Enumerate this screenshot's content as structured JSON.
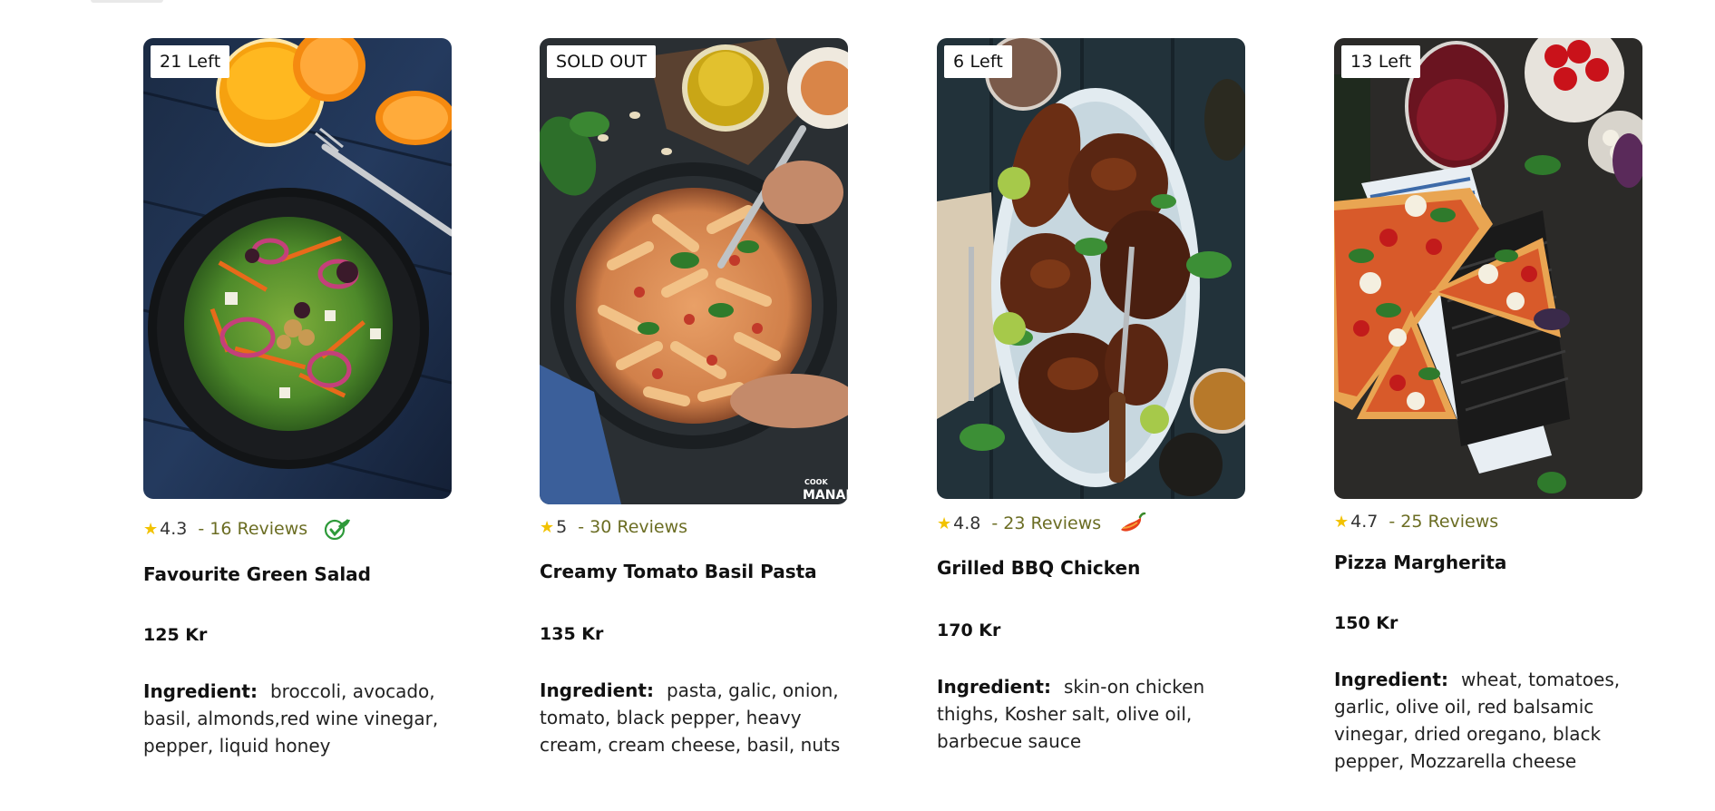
{
  "cards": [
    {
      "stock_badge": "21 Left",
      "rating": "4.3",
      "reviews": "- 16 Reviews",
      "flag_icon": "vegetarian-leaf-icon",
      "name": "Favourite Green Salad",
      "price": "125 Kr",
      "ingredient_label": "Ingredient:",
      "ingredients": "broccoli, avocado, basil, almonds,red wine vinegar, pepper, liquid honey"
    },
    {
      "stock_badge": "SOLD OUT",
      "rating": "5",
      "reviews": "- 30 Reviews",
      "flag_icon": "",
      "name": "Creamy Tomato Basil Pasta",
      "price": "135 Kr",
      "ingredient_label": "Ingredient:",
      "ingredients": "pasta, galic,  onion, tomato, black pepper, heavy cream, cream cheese, basil, nuts",
      "watermark": "COOK WITH MANALI"
    },
    {
      "stock_badge": "6 Left",
      "rating": "4.8",
      "reviews": "- 23 Reviews",
      "flag_icon": "spicy-chili-icon",
      "name": "Grilled BBQ Chicken",
      "price": "170 Kr",
      "ingredient_label": "Ingredient:",
      "ingredients": "skin-on chicken thighs, Kosher salt, olive oil, barbecue sauce"
    },
    {
      "stock_badge": "13 Left",
      "rating": "4.7",
      "reviews": "- 25 Reviews",
      "flag_icon": "",
      "name": "Pizza Margherita",
      "price": "150 Kr",
      "ingredient_label": "Ingredient:",
      "ingredients": "wheat, tomatoes, garlic, olive oil, red balsamic vinegar, dried oregano, black pepper, Mozzarella cheese"
    }
  ],
  "colors": {
    "star": "#f2c200",
    "reviews_text": "#6b6d23",
    "veg_green": "#2e9a3a",
    "chili_red": "#e8401c"
  }
}
